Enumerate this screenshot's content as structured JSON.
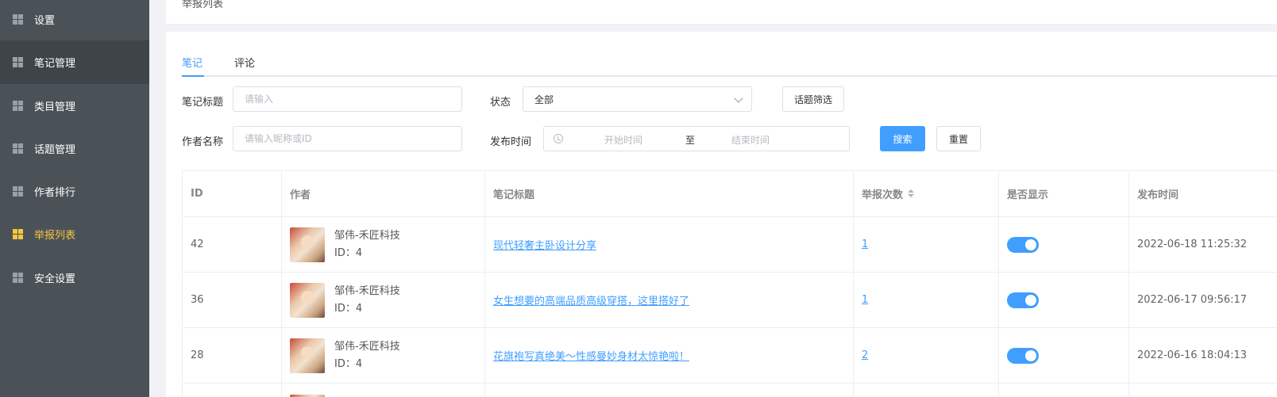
{
  "sidebar": {
    "items": [
      {
        "label": "设置"
      },
      {
        "label": "笔记管理"
      },
      {
        "label": "类目管理"
      },
      {
        "label": "话题管理"
      },
      {
        "label": "作者排行"
      },
      {
        "label": "举报列表"
      },
      {
        "label": "安全设置"
      }
    ]
  },
  "breadcrumb": {
    "label": "举报列表"
  },
  "tabs": [
    {
      "label": "笔记"
    },
    {
      "label": "评论"
    }
  ],
  "filters": {
    "note_title_label": "笔记标题",
    "note_title_placeholder": "请输入",
    "status_label": "状态",
    "status_value": "全部",
    "topic_filter_label": "话题筛选",
    "author_label": "作者名称",
    "author_placeholder": "请输入昵称或ID",
    "publish_time_label": "发布时间",
    "start_placeholder": "开始时间",
    "range_separator": "至",
    "end_placeholder": "结束时间",
    "search_label": "搜索",
    "reset_label": "重置"
  },
  "table": {
    "headers": {
      "id": "ID",
      "author": "作者",
      "title": "笔记标题",
      "reports": "举报次数",
      "visible": "是否显示",
      "time": "发布时间"
    },
    "rows": [
      {
        "id": "42",
        "author": "邹伟-禾匠科技",
        "author_id": "ID：4",
        "title": "现代轻奢主卧设计分享",
        "reports": "1",
        "visible": true,
        "time": "2022-06-18 11:25:32"
      },
      {
        "id": "36",
        "author": "邹伟-禾匠科技",
        "author_id": "ID：4",
        "title": "女生想要的高端品质高级穿搭，这里搭好了",
        "reports": "1",
        "visible": true,
        "time": "2022-06-17 09:56:17"
      },
      {
        "id": "28",
        "author": "邹伟-禾匠科技",
        "author_id": "ID：4",
        "title": "花旗袍写真绝美～性感曼妙身材太惊艳啦！",
        "reports": "2",
        "visible": true,
        "time": "2022-06-16 18:04:13"
      }
    ]
  },
  "colors": {
    "accent": "#409eff",
    "active_menu": "#f7c63f",
    "sidebar_bg": "#4b5257"
  }
}
